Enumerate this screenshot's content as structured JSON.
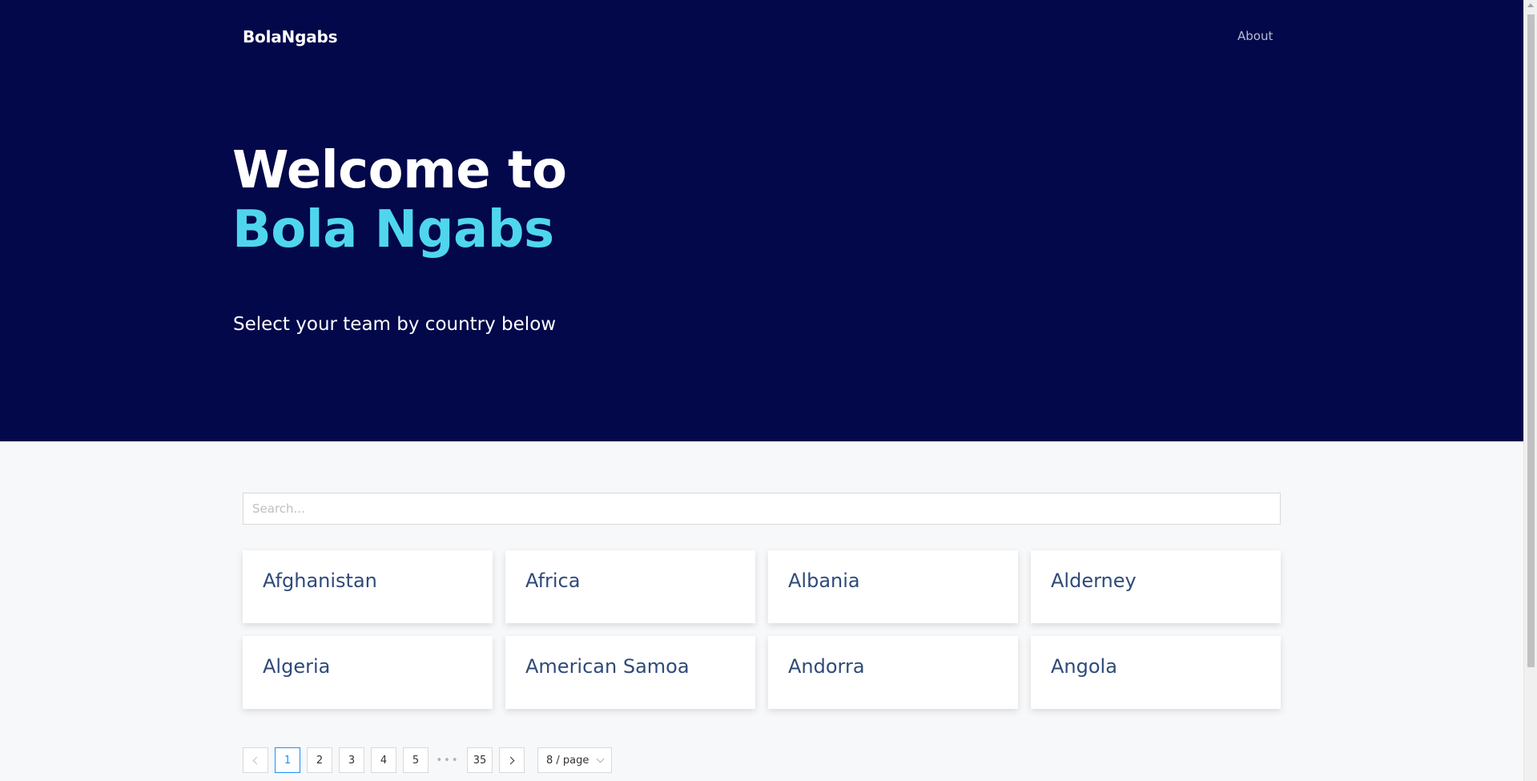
{
  "header": {
    "brand": "BolaNgabs",
    "nav_about": "About"
  },
  "hero": {
    "title_line1": "Welcome to",
    "title_line2": "Bola Ngabs",
    "subtitle": "Select your team by country below"
  },
  "search": {
    "placeholder": "Search...",
    "value": ""
  },
  "countries": [
    "Afghanistan",
    "Africa",
    "Albania",
    "Alderney",
    "Algeria",
    "American Samoa",
    "Andorra",
    "Angola"
  ],
  "pagination": {
    "pages": [
      "1",
      "2",
      "3",
      "4",
      "5"
    ],
    "current": "1",
    "ellipsis": "•••",
    "last_page": "35",
    "page_size": "8 / page"
  },
  "colors": {
    "hero_bg": "#02084a",
    "accent": "#4fd6ee",
    "card_text": "#2e4a7a",
    "active_page": "#1890ff"
  }
}
